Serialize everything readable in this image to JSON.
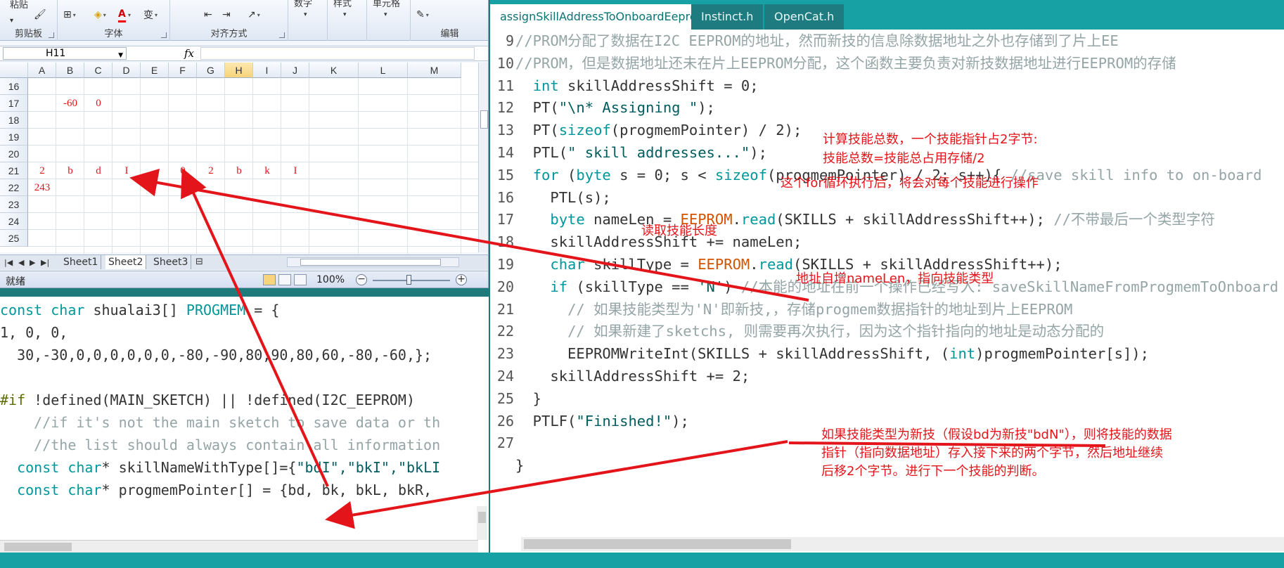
{
  "excel": {
    "ribbon": {
      "clipboard_top": "粘贴",
      "clipboard_label": "剪贴板",
      "font_label": "字体",
      "align_label": "对齐方式",
      "number_top": "数字",
      "style_top": "样式",
      "cells_top": "单元格",
      "edit_label": "编辑"
    },
    "namebox": "H11",
    "fx": "fx",
    "columns": [
      "A",
      "B",
      "C",
      "D",
      "E",
      "F",
      "G",
      "H",
      "I",
      "J",
      "K",
      "L",
      "M"
    ],
    "selected_column": "H",
    "rows": [
      "16",
      "17",
      "18",
      "19",
      "20",
      "21",
      "22",
      "23",
      "24",
      "25"
    ],
    "cells": {
      "r17_B": "-60",
      "r17_C": "0",
      "r21_A": "2",
      "r21_B": "b",
      "r21_C": "d",
      "r21_D": "I",
      "r21_F": "0",
      "r21_G": "2",
      "r21_H": "b",
      "r21_I": "k",
      "r21_J": "I",
      "r22_A": "243"
    },
    "sheet_tabs": [
      "Sheet1",
      "Sheet2",
      "Sheet3"
    ],
    "active_sheet": "Sheet2",
    "status": "就绪",
    "zoom": "100%"
  },
  "left_code": {
    "l1_kw": "const char",
    "l1_rest": " shualai3[] ",
    "l1_kw2": "PROGMEM",
    "l1_end": " = {",
    "l2": "1, 0, 0,",
    "l3": "  30,-30,0,0,0,0,0,0,-80,-90,80,90,80,60,-80,-60,};",
    "l4": "",
    "l5_pp": "#if",
    "l5_rest": " !defined(MAIN_SKETCH) || !defined(I2C_EEPROM)",
    "l6": "    //if it's not the main sketch to save data or th",
    "l7": "    //the list should always contain all information",
    "l8_kw": "const char",
    "l8_rest": "* skillNameWithType[]={",
    "l8_str": "\"bdI\",\"bkI\",\"bkLI",
    "l9_kw": "const char",
    "l9_rest": "* progmemPointer[] = {bd, bk, bkL, bkR,"
  },
  "ide": {
    "tabs": [
      "assignSkillAddressToOnboardEeprom",
      "Instinct.h",
      "OpenCat.h"
    ],
    "active_tab": "assignSkillAddressToOnboardEeprom",
    "lines": [
      {
        "n": "9",
        "html": "<span class=\"cm\">//PROM分配了数据在I2C EEPROM的地址，然而新技的信息除数据地址之外也存储到了片上EE</span>"
      },
      {
        "n": "10",
        "html": "<span class=\"cm\">//PROM，但是数据地址还未在片上EEPROM分配，这个函数主要负责对新技数据地址进行EEPROM的存储</span>"
      },
      {
        "n": "11",
        "html": "  <span class=\"kw\">int</span> skillAddressShift = 0;"
      },
      {
        "n": "12",
        "html": "  PT(<span class=\"str\">\"\\n* Assigning \"</span>);"
      },
      {
        "n": "13",
        "html": "  PT(<span class=\"kw\">sizeof</span>(progmemPointer) / 2);"
      },
      {
        "n": "14",
        "html": "  PTL(<span class=\"str\">\" skill addresses...\"</span>);"
      },
      {
        "n": "15",
        "html": "  <span class=\"kw\">for</span> (<span class=\"kw\">byte</span> s = 0; s &lt; <span class=\"kw\">sizeof</span>(progmemPointer) / 2; s++){ <span class=\"cm\">//save skill info to on-board</span>"
      },
      {
        "n": "16",
        "html": "    PTL(s);"
      },
      {
        "n": "17",
        "html": "    <span class=\"kw\">byte</span> nameLen = <span class=\"fn\">EEPROM</span>.<span class=\"kw\">read</span>(SKILLS + skillAddressShift++); <span class=\"cm\">//不带最后一个类型字符</span>"
      },
      {
        "n": "18",
        "html": "    skillAddressShift += nameLen;"
      },
      {
        "n": "19",
        "html": "    <span class=\"kw\">char</span> skillType = <span class=\"fn\">EEPROM</span>.<span class=\"kw\">read</span>(SKILLS + skillAddressShift++);"
      },
      {
        "n": "20",
        "html": "    <span class=\"kw\">if</span> (skillType == <span class=\"str\">'N'</span>) <span class=\"cm\">//本能的地址在前一个操作已经写入: saveSkillNameFromProgmemToOnboard</span>"
      },
      {
        "n": "21",
        "html": "      <span class=\"cm\">// 如果技能类型为'N'即新技,，存储progmem数据指针的地址到片上EEPROM</span>"
      },
      {
        "n": "22",
        "html": "      <span class=\"cm\">// 如果新建了sketchs, 则需要再次执行，因为这个指针指向的地址是动态分配的</span>"
      },
      {
        "n": "23",
        "html": "      EEPROMWriteInt(SKILLS + skillAddressShift, (<span class=\"kw\">int</span>)progmemPointer[s]);"
      },
      {
        "n": "24",
        "html": "    skillAddressShift += 2;"
      },
      {
        "n": "25",
        "html": "  }"
      },
      {
        "n": "26",
        "html": "  PTLF(<span class=\"str\">\"Finished!\"</span>);"
      },
      {
        "n": "27",
        "html": ""
      },
      {
        "n": "",
        "html": "}"
      }
    ]
  },
  "notes": {
    "n13a": "计算技能总数，一个技能指针占2字节:",
    "n13b": "技能总数=技能总占用存储/2",
    "n14": "这个for循环执行后，将会对每个技能进行操作",
    "n16": "读取技能长度",
    "n18": "地址自增nameLen，指向技能类型",
    "n24a": "如果技能类型为新技（假设bd为新技\"bdN\"），则将技能的数据",
    "n24b": "指针（指向数据地址）存入接下来的两个字节，然后地址继续",
    "n24c": "后移2个字节。进行下一个技能的判断。"
  },
  "colors": {
    "annotation": "#e3151a",
    "ide_teal": "#17a1a5",
    "keyword": "#00979c"
  }
}
